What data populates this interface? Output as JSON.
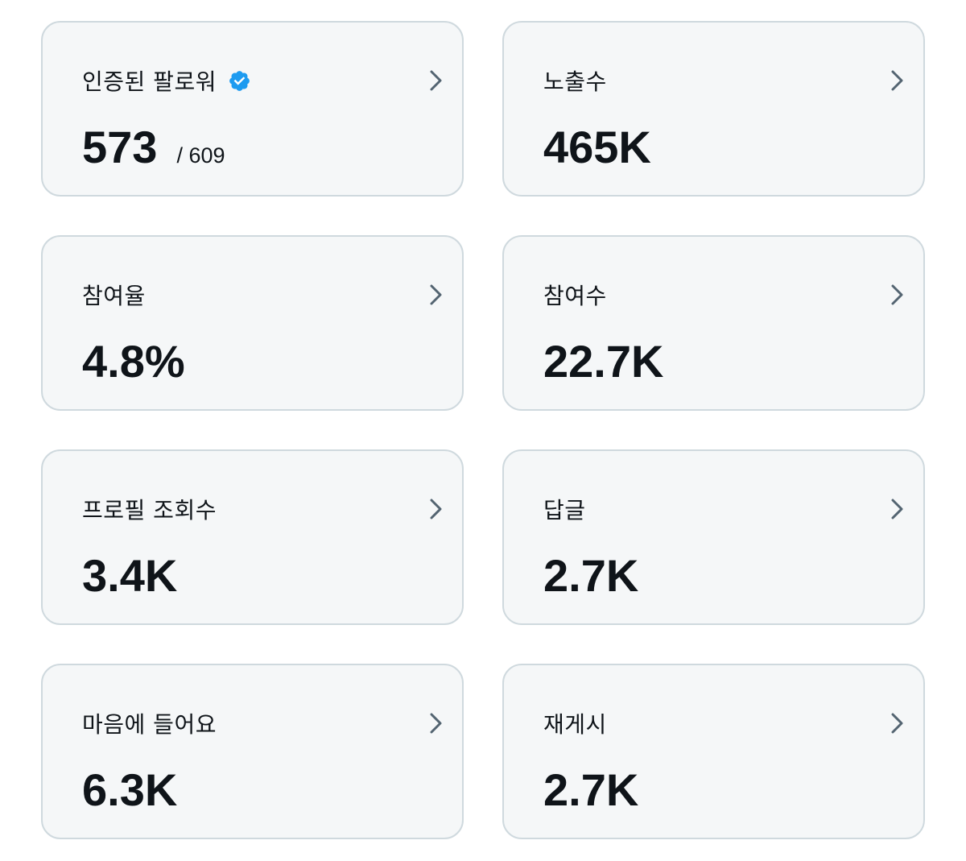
{
  "colors": {
    "card_background": "#f5f7f8",
    "card_border": "#cfd9de",
    "text": "#0f1419",
    "chevron": "#536471",
    "verified": "#1d9bf0"
  },
  "cards": [
    {
      "label": "인증된 팔로워",
      "value": "573",
      "sub": "/ 609",
      "icon": "verified-badge-icon"
    },
    {
      "label": "노출수",
      "value": "465K"
    },
    {
      "label": "참여율",
      "value": "4.8%"
    },
    {
      "label": "참여수",
      "value": "22.7K"
    },
    {
      "label": "프로필 조회수",
      "value": "3.4K"
    },
    {
      "label": "답글",
      "value": "2.7K"
    },
    {
      "label": "마음에 들어요",
      "value": "6.3K"
    },
    {
      "label": "재게시",
      "value": "2.7K"
    }
  ]
}
